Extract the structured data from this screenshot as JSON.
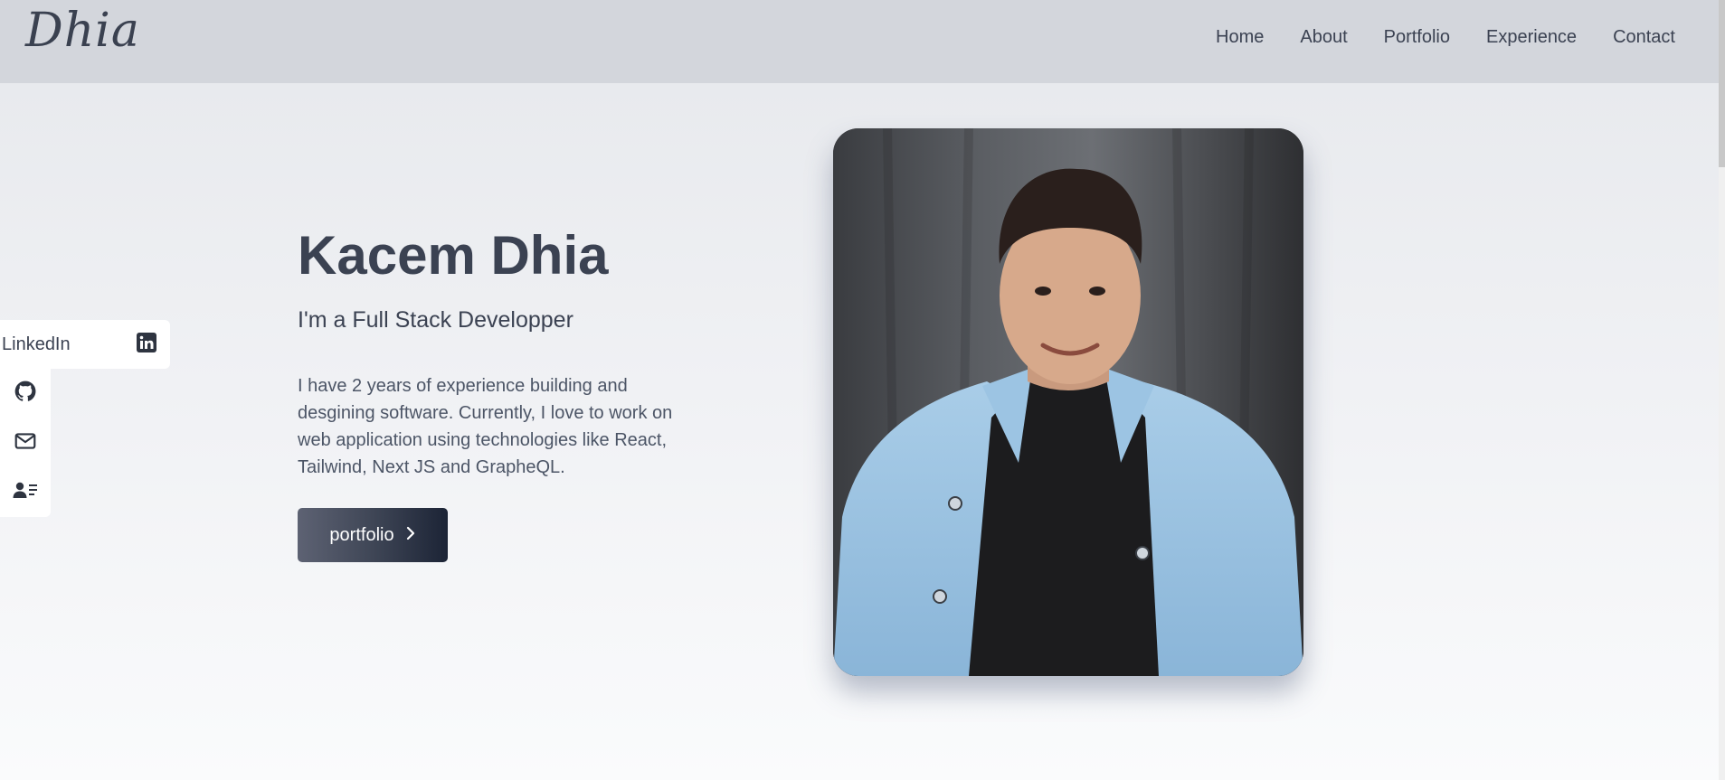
{
  "header": {
    "logo": "Dhia",
    "nav": [
      "Home",
      "About",
      "Portfolio",
      "Experience",
      "Contact"
    ]
  },
  "social": {
    "linkedin_label": "LinkedIn",
    "icons": [
      "linkedin-icon",
      "github-icon",
      "mail-icon",
      "resume-icon"
    ]
  },
  "hero": {
    "name": "Kacem Dhia",
    "subtitle": "I'm a Full Stack Developper",
    "description": "I have 2 years of experience building and desgining software. Currently, I love to work on web application using technologies like React, Tailwind, Next JS and GrapheQL.",
    "button_label": "portfolio"
  },
  "colors": {
    "header_bg": "#d3d6dc",
    "text": "#3b4252",
    "button_start": "#5d6273",
    "button_end": "#1c2436"
  }
}
